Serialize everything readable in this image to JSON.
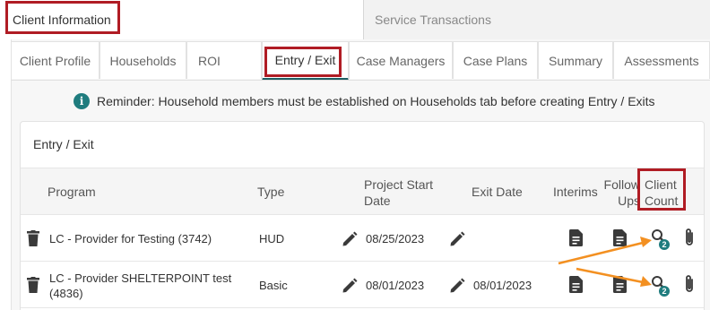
{
  "top_tabs": [
    {
      "label": "Client Information"
    },
    {
      "label": "Service Transactions"
    }
  ],
  "sub_tabs": [
    {
      "label": "Client Profile"
    },
    {
      "label": "Households"
    },
    {
      "label": "ROI"
    },
    {
      "label": "Entry / Exit"
    },
    {
      "label": "Case Managers"
    },
    {
      "label": "Case Plans"
    },
    {
      "label": "Summary"
    },
    {
      "label": "Assessments"
    }
  ],
  "reminder": {
    "text": "Reminder: Household members must be established on Households tab before creating Entry / Exits"
  },
  "section": {
    "title": "Entry / Exit"
  },
  "table": {
    "headers": {
      "program": "Program",
      "type": "Type",
      "start_line1": "Project Start",
      "start_line2": "Date",
      "exit": "Exit Date",
      "interims": "Interims",
      "follow_line1": "Follow",
      "follow_line2": "Ups",
      "count_line1": "Client",
      "count_line2": "Count"
    },
    "rows": [
      {
        "program_line1": "LC - Provider for Testing (3742)",
        "program_line2": "",
        "type": "HUD",
        "start_date": "08/25/2023",
        "exit_date": "",
        "client_count": "2"
      },
      {
        "program_line1": "LC - Provider SHELTERPOINT test",
        "program_line2": "(4836)",
        "type": "Basic",
        "start_date": "08/01/2023",
        "exit_date": "08/01/2023",
        "client_count": "2"
      }
    ]
  },
  "icons": {
    "info": "info-circle-icon",
    "delete": "trash-icon",
    "edit": "pencil-icon",
    "interim": "document-icon",
    "follow_up": "document-icon",
    "client_count": "search-icon",
    "attachment": "paperclip-icon"
  },
  "colors": {
    "teal_accent": "#1f7c7e",
    "highlight_box": "#b01c24",
    "annotation_arrow": "#f39021"
  }
}
